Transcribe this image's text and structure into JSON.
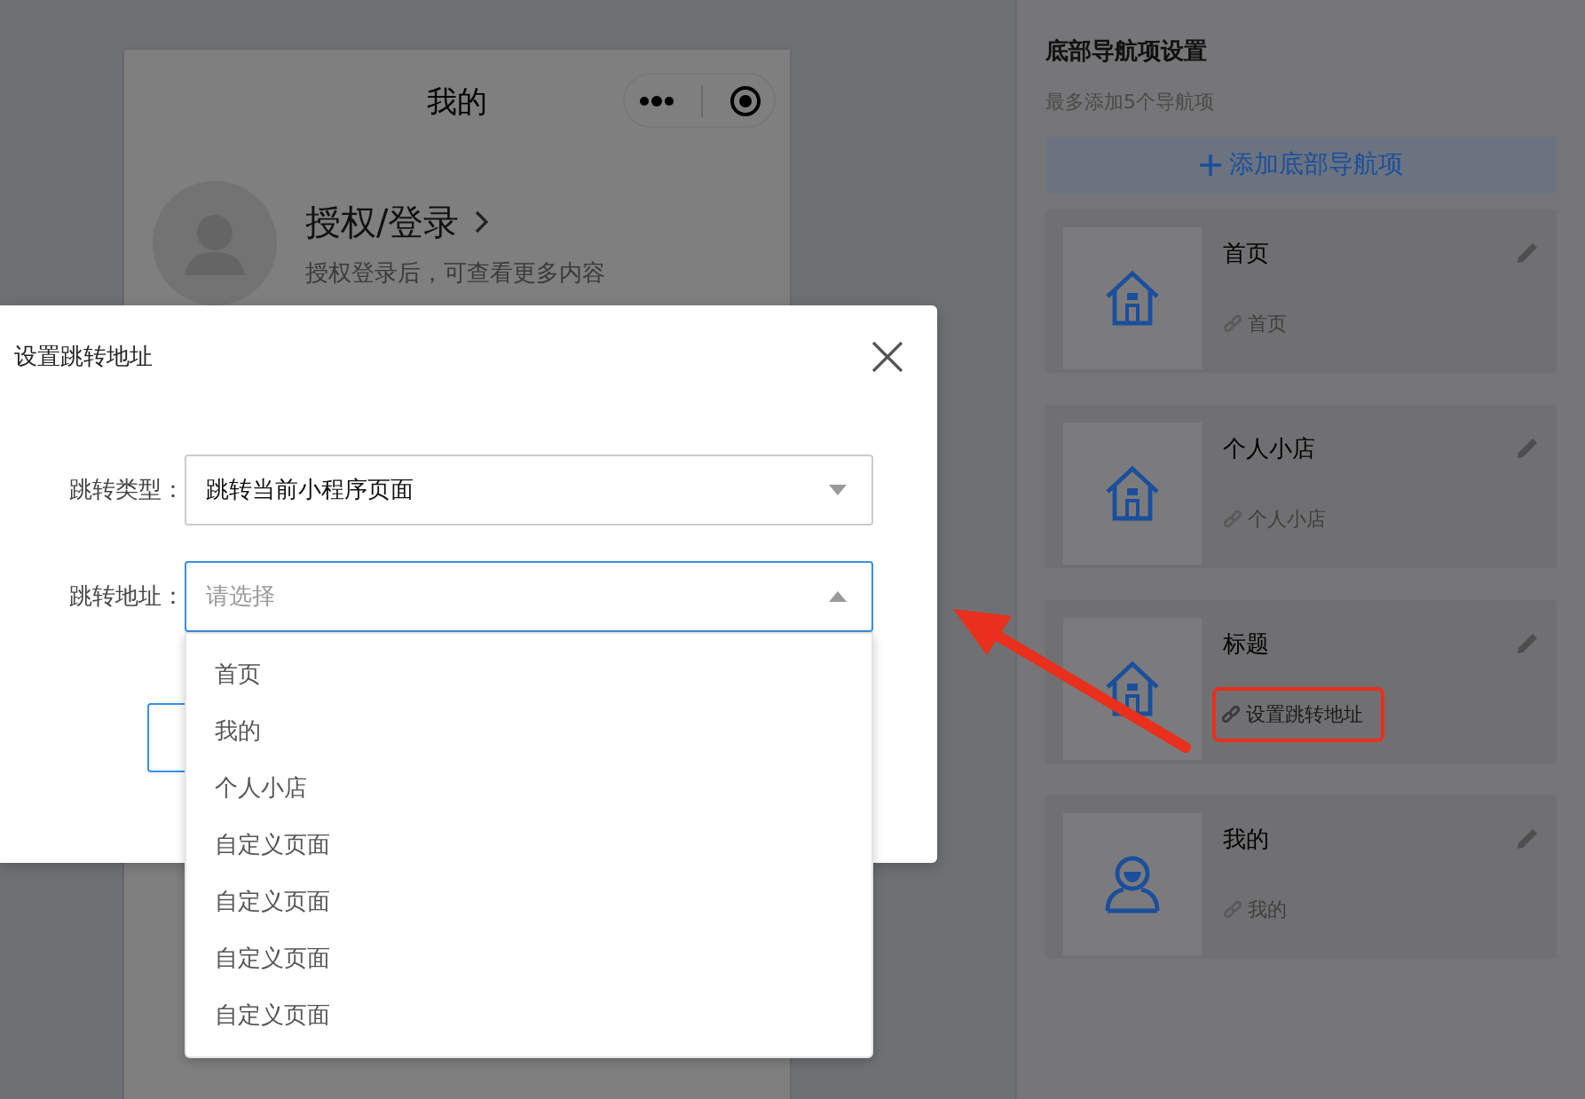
{
  "phone": {
    "title": "我的",
    "login_title": "授权/登录",
    "login_subtitle": "授权登录后，可查看更多内容"
  },
  "nav_settings": {
    "title": "底部导航项设置",
    "hint": "最多添加5个导航项",
    "add_button": "添加底部导航项",
    "items": [
      {
        "title": "首页",
        "link": "首页",
        "link_set": true,
        "kind": "house",
        "highlighted": false
      },
      {
        "title": "个人小店",
        "link": "个人小店",
        "link_set": true,
        "kind": "house",
        "highlighted": false
      },
      {
        "title": "标题",
        "link": "设置跳转地址",
        "link_set": false,
        "kind": "house",
        "highlighted": true
      },
      {
        "title": "我的",
        "link": "我的",
        "link_set": true,
        "kind": "person",
        "highlighted": false
      }
    ]
  },
  "modal": {
    "title": "设置跳转地址",
    "fields": [
      {
        "label": "跳转类型：",
        "value": "跳转当前小程序页面",
        "expanded": false
      },
      {
        "label": "跳转地址：",
        "placeholder": "请选择",
        "expanded": true
      }
    ],
    "options": [
      "首页",
      "我的",
      "个人小店",
      "自定义页面",
      "自定义页面",
      "自定义页面",
      "自定义页面"
    ]
  }
}
